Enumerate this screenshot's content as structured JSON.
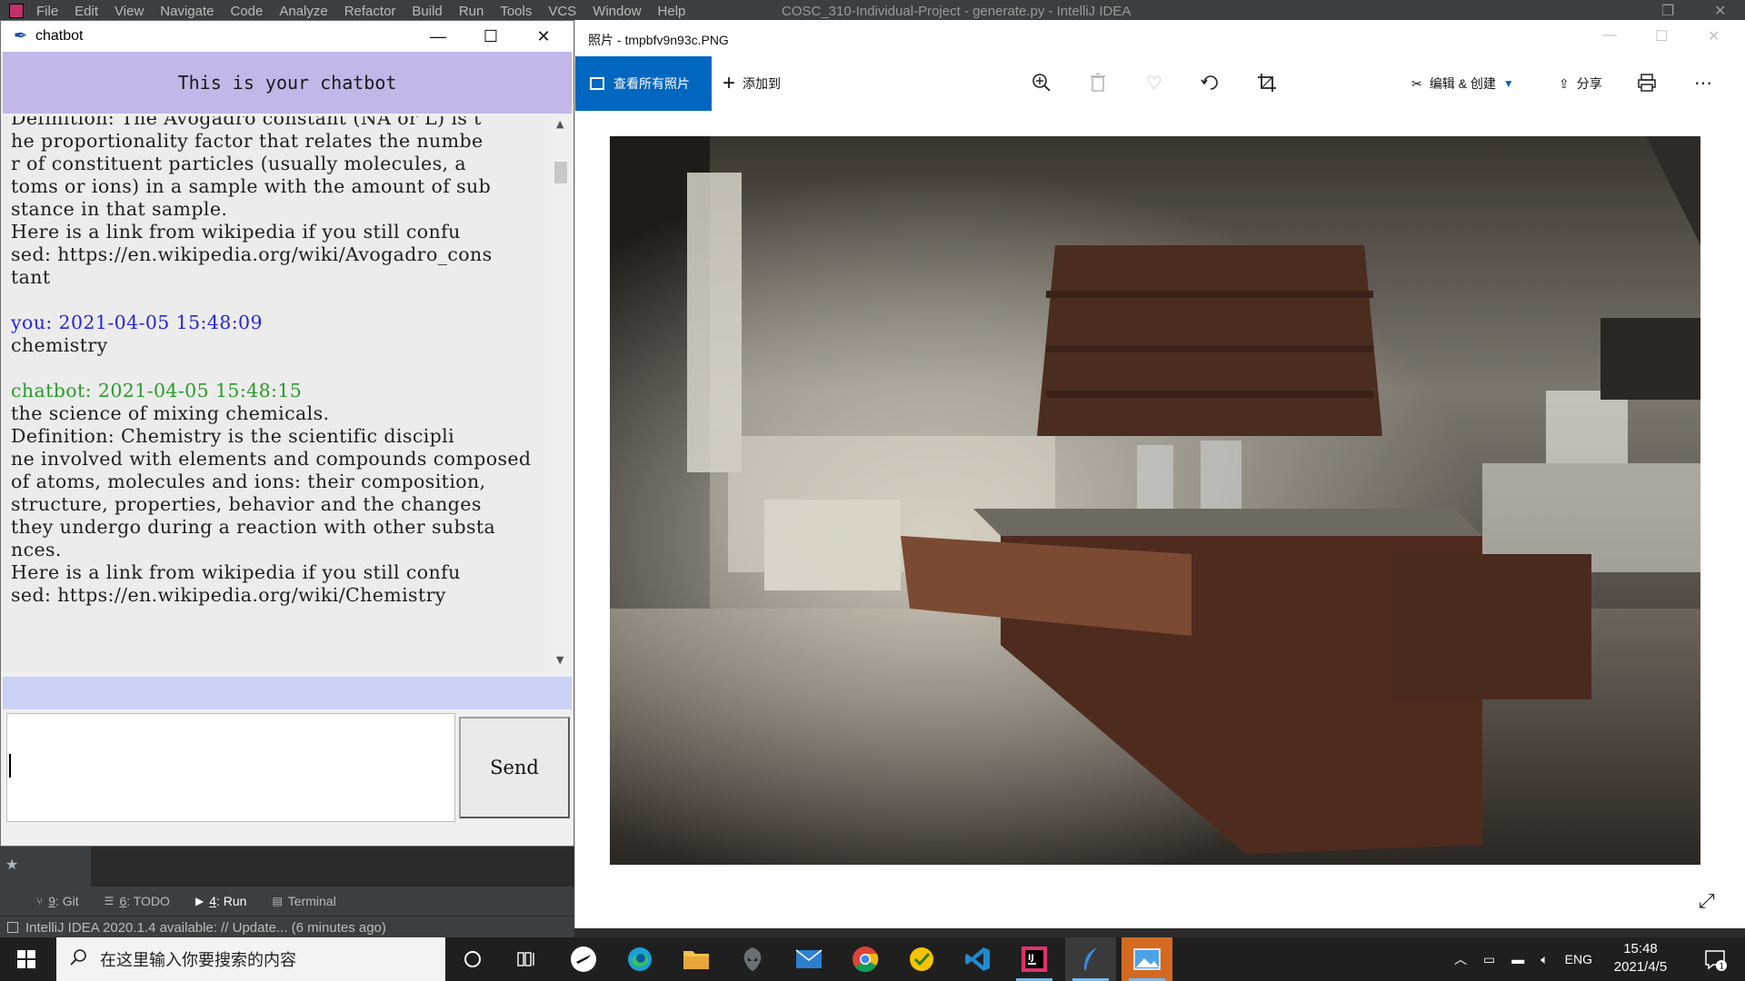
{
  "ide": {
    "menu": [
      "File",
      "Edit",
      "View",
      "Navigate",
      "Code",
      "Analyze",
      "Refactor",
      "Build",
      "Run",
      "Tools",
      "VCS",
      "Window",
      "Help"
    ],
    "title": "COSC_310-Individual-Project - generate.py - IntelliJ IDEA",
    "tool_windows": [
      {
        "num": "9",
        "label": ": Git",
        "icon": "git-branch-icon"
      },
      {
        "num": "6",
        "label": ": TODO",
        "icon": "list-icon"
      },
      {
        "num": "4",
        "label": ": Run",
        "icon": "run-icon"
      },
      {
        "num": "",
        "label": "Terminal",
        "icon": "terminal-icon"
      }
    ],
    "status_text": "IntelliJ IDEA 2020.1.4 available: // Update... (6 minutes ago)"
  },
  "chatbot": {
    "window_title": "chatbot",
    "header": "This is your chatbot",
    "messages": [
      {
        "kind": "text",
        "text": "Definition: The Avogadro constant (NA or L) is t"
      },
      {
        "kind": "text",
        "text": "he proportionality factor that relates the numbe"
      },
      {
        "kind": "text",
        "text": "r of constituent particles (usually molecules, a"
      },
      {
        "kind": "text",
        "text": "toms or ions) in a sample with the amount of sub"
      },
      {
        "kind": "text",
        "text": "stance in that sample."
      },
      {
        "kind": "text",
        "text": "Here is a link from wikipedia if you still confu"
      },
      {
        "kind": "text",
        "text": "sed: https://en.wikipedia.org/wiki/Avogadro_cons"
      },
      {
        "kind": "text",
        "text": "tant"
      },
      {
        "kind": "blank",
        "text": " "
      },
      {
        "kind": "you",
        "text": "you: 2021-04-05 15:48:09"
      },
      {
        "kind": "text",
        "text": "chemistry"
      },
      {
        "kind": "blank",
        "text": " "
      },
      {
        "kind": "bot",
        "text": "chatbot: 2021-04-05 15:48:15"
      },
      {
        "kind": "text",
        "text": "the science of mixing chemicals."
      },
      {
        "kind": "text",
        "text": "Definition: Chemistry is the scientific discipli"
      },
      {
        "kind": "text",
        "text": "ne involved with elements and compounds composed"
      },
      {
        "kind": "text",
        "text": "of atoms, molecules and ions: their composition,"
      },
      {
        "kind": "text",
        "text": "structure, properties, behavior and the changes"
      },
      {
        "kind": "text",
        "text": "they undergo during a reaction with other substa"
      },
      {
        "kind": "text",
        "text": "nces."
      },
      {
        "kind": "text",
        "text": "Here is a link from wikipedia if you still confu"
      },
      {
        "kind": "text",
        "text": "sed: https://en.wikipedia.org/wiki/Chemistry"
      }
    ],
    "input_value": "",
    "send_label": "Send",
    "colors": {
      "header_bg": "#c2b7e8",
      "you": "#2626d8",
      "bot": "#2b9a2b",
      "strip": "#c9d2f5"
    }
  },
  "photos": {
    "window_title": "照片 - tmpbfv9n93c.PNG",
    "view_all_label": "查看所有照片",
    "add_to_label": "添加到",
    "edit_create_label": "编辑 & 创建",
    "share_label": "分享",
    "accent": "#0067c0"
  },
  "taskbar": {
    "search_placeholder": "在这里输入你要搜索的内容",
    "apps": [
      "cortana-icon",
      "task-view-icon",
      "forza-icon",
      "edge-icon",
      "file-explorer-icon",
      "alienware-icon",
      "mail-icon",
      "chrome-icon",
      "norton-icon",
      "vscode-icon",
      "intellij-icon",
      "python-feather-icon",
      "photos-icon"
    ],
    "lang": "ENG",
    "time": "15:48",
    "date": "2021/4/5",
    "notification_count": "1"
  }
}
